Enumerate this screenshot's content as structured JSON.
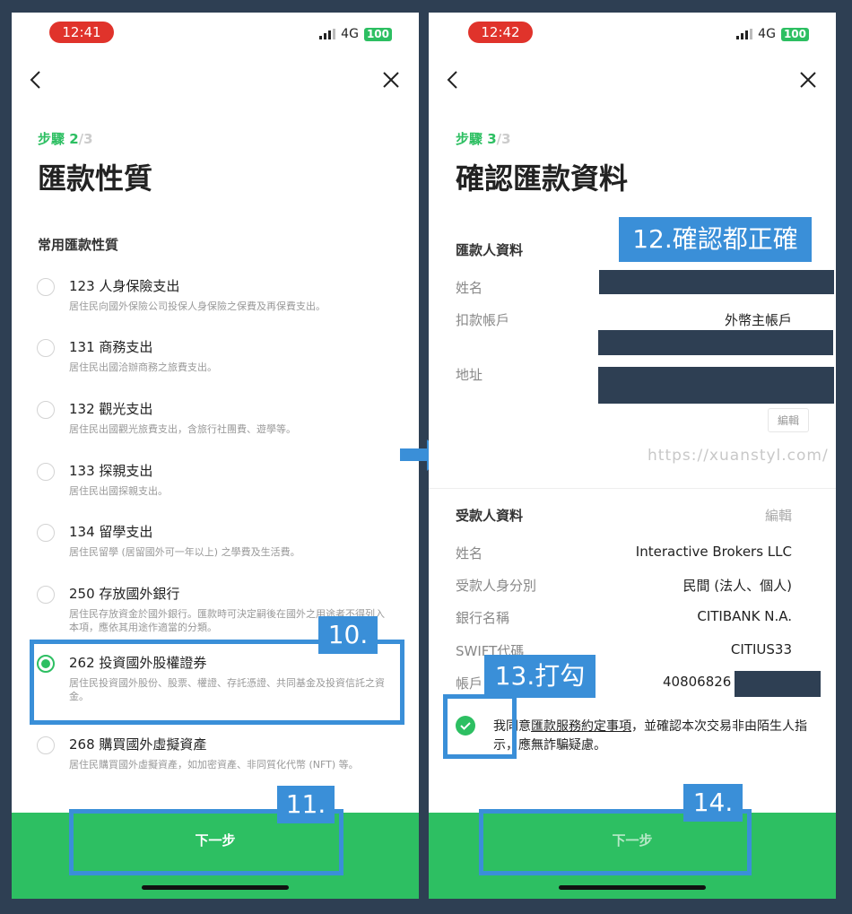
{
  "left": {
    "status": {
      "time": "12:41",
      "network": "4G",
      "battery": "100"
    },
    "step": {
      "current": "步驟 2",
      "total": "/3"
    },
    "title": "匯款性質",
    "section_label": "常用匯款性質",
    "options": [
      {
        "label": "123 人身保險支出",
        "desc": "居住民向國外保險公司投保人身保險之保費及再保費支出。"
      },
      {
        "label": "131 商務支出",
        "desc": "居住民出國洽辦商務之旅費支出。"
      },
      {
        "label": "132 觀光支出",
        "desc": "居住民出國觀光旅費支出，含旅行社團費、遊學等。"
      },
      {
        "label": "133 探親支出",
        "desc": "居住民出國探親支出。"
      },
      {
        "label": "134 留學支出",
        "desc": "居住民留學 (居留國外可一年以上) 之學費及生活費。"
      },
      {
        "label": "250 存放國外銀行",
        "desc": "居住民存放資金於國外銀行。匯款時可決定嗣後在國外之用途者不得列入本項，應依其用途作適當的分類。"
      },
      {
        "label": "262 投資國外股權證券",
        "desc": "居住民投資國外股份、股票、權證、存託憑證、共同基金及投資信託之資金。",
        "selected": true
      },
      {
        "label": "268 購買國外虛擬資產",
        "desc": "居住民購買國外虛擬資產，如加密資產、非同質化代幣 (NFT) 等。"
      }
    ],
    "next_button": "下一步",
    "annotations": {
      "selection": "10.",
      "next": "11."
    }
  },
  "right": {
    "status": {
      "time": "12:42",
      "network": "4G",
      "battery": "100"
    },
    "step": {
      "current": "步驟 3",
      "total": "/3"
    },
    "title": "確認匯款資料",
    "remitter": {
      "heading": "匯款人資料",
      "name_label": "姓名",
      "account_label": "扣款帳戶",
      "account_value": "外幣主帳戶",
      "address_label": "地址",
      "edit": "編輯"
    },
    "beneficiary": {
      "heading": "受款人資料",
      "edit": "編輯",
      "rows": [
        {
          "label": "姓名",
          "value": "Interactive Brokers LLC"
        },
        {
          "label": "受款人身分別",
          "value": "民間 (法人、個人)"
        },
        {
          "label": "銀行名稱",
          "value": "CITIBANK N.A."
        },
        {
          "label": "SWIFT代碼",
          "value": "CITIUS33"
        },
        {
          "label": "帳戶",
          "value": "40806826"
        }
      ]
    },
    "consent": {
      "pre": "我同意",
      "link": "匯款服務約定事項",
      "post": "，並確認本次交易非由陌生人指示，應無詐騙疑慮。"
    },
    "next_button": "下一步",
    "annotations": {
      "confirm": "12.確認都正確",
      "check": "13.打勾",
      "next": "14."
    }
  },
  "watermark": "https://xuanstyl.com/",
  "colors": {
    "accent": "#2dbf62",
    "annotation": "#3a8fd8",
    "background": "#2e3f53",
    "time_pill": "#e0332b"
  }
}
